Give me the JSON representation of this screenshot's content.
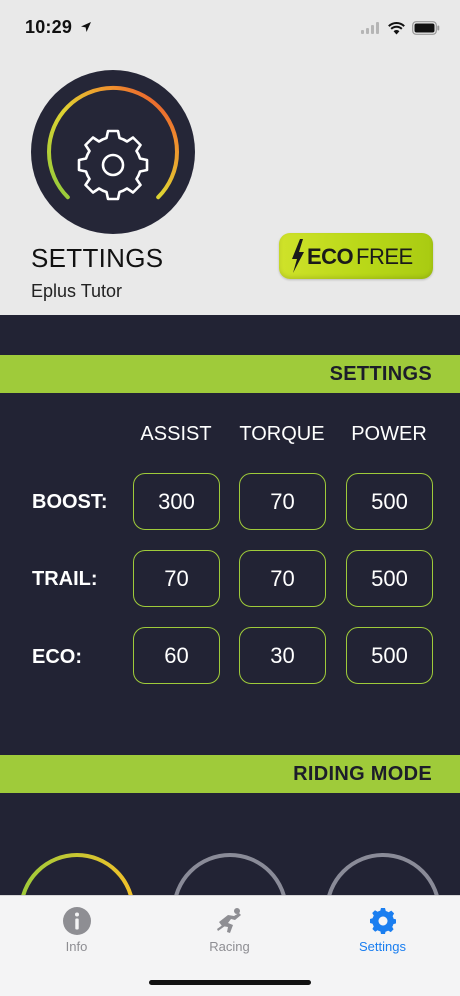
{
  "status": {
    "time": "10:29"
  },
  "header": {
    "title": "SETTINGS",
    "subtitle": "Eplus Tutor",
    "badge": {
      "strong": "ECO",
      "light": "FREE"
    }
  },
  "settings": {
    "section_title": "SETTINGS",
    "columns": [
      "ASSIST",
      "TORQUE",
      "POWER"
    ],
    "rows": [
      {
        "label": "BOOST:",
        "values": [
          "300",
          "70",
          "500"
        ]
      },
      {
        "label": "TRAIL:",
        "values": [
          "70",
          "70",
          "500"
        ]
      },
      {
        "label": "ECO:",
        "values": [
          "60",
          "30",
          "500"
        ]
      }
    ]
  },
  "riding_mode": {
    "section_title": "RIDING MODE"
  },
  "tabs": [
    {
      "label": "Info",
      "icon": "info-icon",
      "active": false
    },
    {
      "label": "Racing",
      "icon": "rider-icon",
      "active": false
    },
    {
      "label": "Settings",
      "icon": "gear-icon",
      "active": true
    }
  ],
  "colors": {
    "accent_green": "#9fcb3a",
    "dark_background": "#222334",
    "active_tab": "#1a7ef0"
  }
}
